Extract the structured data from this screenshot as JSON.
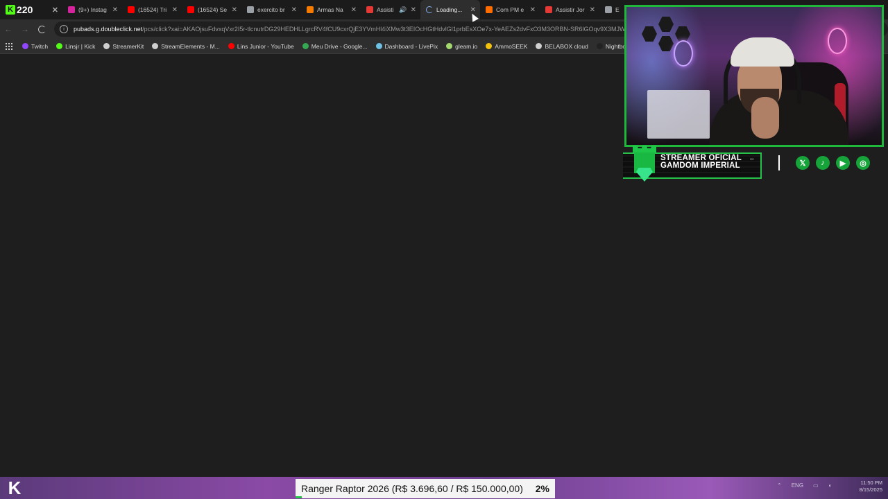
{
  "kick_tab": {
    "count": "220",
    "logo": "K"
  },
  "tabs": [
    {
      "title": "(9+) Instag",
      "fav_color": "#d6249f",
      "active": false
    },
    {
      "title": "(16524) Tri",
      "fav_color": "#ff0000",
      "active": false
    },
    {
      "title": "(16524) Se",
      "fav_color": "#ff0000",
      "active": false
    },
    {
      "title": "exercito br",
      "fav_color": "#9aa0a6",
      "active": false
    },
    {
      "title": "Armas Na",
      "fav_color": "#f57c00",
      "active": false
    },
    {
      "title": "Assisti",
      "fav_color": "#e53935",
      "active": false,
      "audio": true
    },
    {
      "title": "Loading...",
      "fav_color": "#8ab4f8",
      "active": true,
      "loading": true
    },
    {
      "title": "Com PM e",
      "fav_color": "#ff6d00",
      "active": false
    },
    {
      "title": "Assistir Jor",
      "fav_color": "#e53935",
      "active": false
    },
    {
      "title": "E",
      "fav_color": "#9aa0a6",
      "active": false
    }
  ],
  "address": {
    "host": "pubads.g.doubleclick.net",
    "path": "/pcs/click?xai=AKAOjsuFdvxqVxr2I5r-tlcnutrDG29HEDHLLgrcRV4fCU9cxrQjE3YVmHl4iXMw3t3EIOcHGtHdvlGl1prbEsXOe7x-YeAEZs2dvFxO3M3ORBN-SR6lGOqv9X3MJW"
  },
  "bookmarks": [
    {
      "label": "Twitch",
      "color": "#9146ff"
    },
    {
      "label": "Linsjr | Kick",
      "color": "#53fc18"
    },
    {
      "label": "StreamerKit",
      "color": "#cfcfcf"
    },
    {
      "label": "StreamElements - M...",
      "color": "#cfcfcf"
    },
    {
      "label": "Lins Junior - YouTube",
      "color": "#ff0000"
    },
    {
      "label": "Meu Drive - Google...",
      "color": "#34a853"
    },
    {
      "label": "Dashboard - LivePix",
      "color": "#6ec1e4"
    },
    {
      "label": "gleam.io",
      "color": "#a3d96f"
    },
    {
      "label": "AmmoSEEK",
      "color": "#f4c20d"
    },
    {
      "label": "BELABOX cloud",
      "color": "#cfcfcf"
    },
    {
      "label": "Nightbot - Comm",
      "color": "#222222"
    }
  ],
  "overlay": {
    "banner_line1": "STREAMER OFICIAL",
    "banner_line2": "GAMDOM IMPERIAL",
    "banner_dash": "–",
    "socials": [
      {
        "name": "x-icon",
        "glyph": "𝕏"
      },
      {
        "name": "tiktok-icon",
        "glyph": "♪"
      },
      {
        "name": "youtube-icon",
        "glyph": "▶"
      },
      {
        "name": "instagram-icon",
        "glyph": "◎"
      }
    ],
    "accent": "#27c24a"
  },
  "goal": {
    "text": "Ranger Raptor 2026 (R$ 3.696,60 / R$ 150.000,00)",
    "percent_label": "2%",
    "fraction": 0.0246
  },
  "taskbar": {
    "logo": "K",
    "tray_lang": "ENG",
    "clock_time": "11:50 PM",
    "clock_date": "8/15/2025"
  }
}
